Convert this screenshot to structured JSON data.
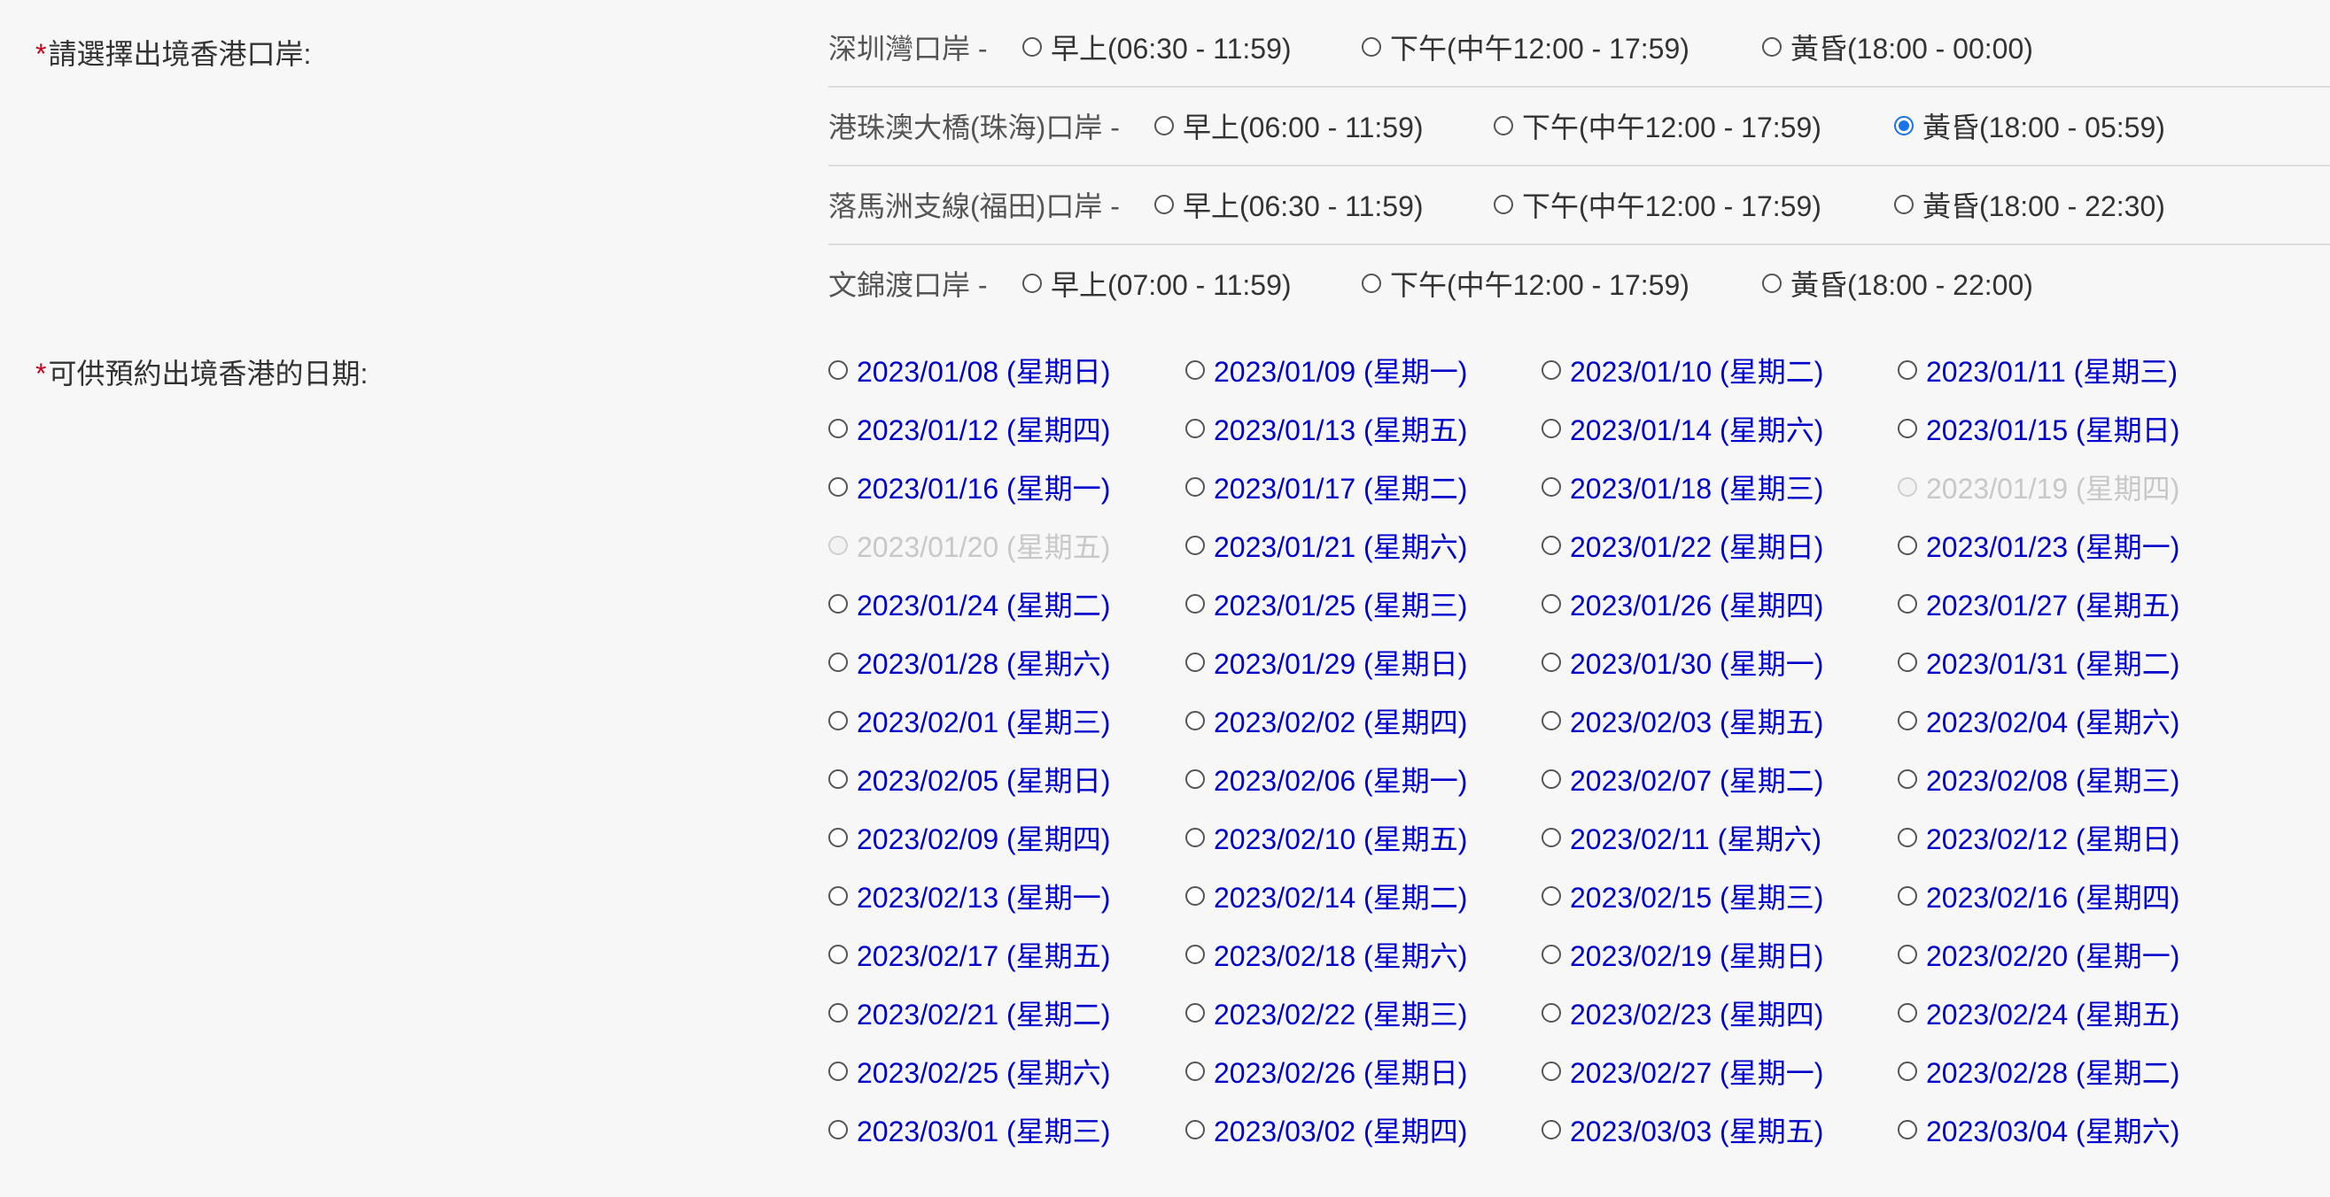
{
  "port_field": {
    "required_mark": "*",
    "label": "請選擇出境香港口岸:"
  },
  "ports": [
    {
      "name": "深圳灣口岸 -",
      "slots": [
        {
          "label": "早上(06:30 - 11:59)",
          "checked": false
        },
        {
          "label": "下午(中午12:00 - 17:59)",
          "checked": false
        },
        {
          "label": "黃昏(18:00 - 00:00)",
          "checked": false
        }
      ]
    },
    {
      "name": "港珠澳大橋(珠海)口岸 -",
      "slots": [
        {
          "label": "早上(06:00 - 11:59)",
          "checked": false
        },
        {
          "label": "下午(中午12:00 - 17:59)",
          "checked": false
        },
        {
          "label": "黃昏(18:00 - 05:59)",
          "checked": true
        }
      ]
    },
    {
      "name": "落馬洲支線(福田)口岸 -",
      "slots": [
        {
          "label": "早上(06:30 - 11:59)",
          "checked": false
        },
        {
          "label": "下午(中午12:00 - 17:59)",
          "checked": false
        },
        {
          "label": "黃昏(18:00 - 22:30)",
          "checked": false
        }
      ]
    },
    {
      "name": "文錦渡口岸 -",
      "slots": [
        {
          "label": "早上(07:00 - 11:59)",
          "checked": false
        },
        {
          "label": "下午(中午12:00 - 17:59)",
          "checked": false
        },
        {
          "label": "黃昏(18:00 - 22:00)",
          "checked": false
        }
      ]
    }
  ],
  "date_field": {
    "required_mark": "*",
    "label": "可供預約出境香港的日期:"
  },
  "dates": [
    {
      "label": "2023/01/08 (星期日)",
      "disabled": false
    },
    {
      "label": "2023/01/09 (星期一)",
      "disabled": false
    },
    {
      "label": "2023/01/10 (星期二)",
      "disabled": false
    },
    {
      "label": "2023/01/11 (星期三)",
      "disabled": false
    },
    {
      "label": "2023/01/12 (星期四)",
      "disabled": false
    },
    {
      "label": "2023/01/13 (星期五)",
      "disabled": false
    },
    {
      "label": "2023/01/14 (星期六)",
      "disabled": false
    },
    {
      "label": "2023/01/15 (星期日)",
      "disabled": false
    },
    {
      "label": "2023/01/16 (星期一)",
      "disabled": false
    },
    {
      "label": "2023/01/17 (星期二)",
      "disabled": false
    },
    {
      "label": "2023/01/18 (星期三)",
      "disabled": false
    },
    {
      "label": "2023/01/19 (星期四)",
      "disabled": true
    },
    {
      "label": "2023/01/20 (星期五)",
      "disabled": true
    },
    {
      "label": "2023/01/21 (星期六)",
      "disabled": false
    },
    {
      "label": "2023/01/22 (星期日)",
      "disabled": false
    },
    {
      "label": "2023/01/23 (星期一)",
      "disabled": false
    },
    {
      "label": "2023/01/24 (星期二)",
      "disabled": false
    },
    {
      "label": "2023/01/25 (星期三)",
      "disabled": false
    },
    {
      "label": "2023/01/26 (星期四)",
      "disabled": false
    },
    {
      "label": "2023/01/27 (星期五)",
      "disabled": false
    },
    {
      "label": "2023/01/28 (星期六)",
      "disabled": false
    },
    {
      "label": "2023/01/29 (星期日)",
      "disabled": false
    },
    {
      "label": "2023/01/30 (星期一)",
      "disabled": false
    },
    {
      "label": "2023/01/31 (星期二)",
      "disabled": false
    },
    {
      "label": "2023/02/01 (星期三)",
      "disabled": false
    },
    {
      "label": "2023/02/02 (星期四)",
      "disabled": false
    },
    {
      "label": "2023/02/03 (星期五)",
      "disabled": false
    },
    {
      "label": "2023/02/04 (星期六)",
      "disabled": false
    },
    {
      "label": "2023/02/05 (星期日)",
      "disabled": false
    },
    {
      "label": "2023/02/06 (星期一)",
      "disabled": false
    },
    {
      "label": "2023/02/07 (星期二)",
      "disabled": false
    },
    {
      "label": "2023/02/08 (星期三)",
      "disabled": false
    },
    {
      "label": "2023/02/09 (星期四)",
      "disabled": false
    },
    {
      "label": "2023/02/10 (星期五)",
      "disabled": false
    },
    {
      "label": "2023/02/11 (星期六)",
      "disabled": false
    },
    {
      "label": "2023/02/12 (星期日)",
      "disabled": false
    },
    {
      "label": "2023/02/13 (星期一)",
      "disabled": false
    },
    {
      "label": "2023/02/14 (星期二)",
      "disabled": false
    },
    {
      "label": "2023/02/15 (星期三)",
      "disabled": false
    },
    {
      "label": "2023/02/16 (星期四)",
      "disabled": false
    },
    {
      "label": "2023/02/17 (星期五)",
      "disabled": false
    },
    {
      "label": "2023/02/18 (星期六)",
      "disabled": false
    },
    {
      "label": "2023/02/19 (星期日)",
      "disabled": false
    },
    {
      "label": "2023/02/20 (星期一)",
      "disabled": false
    },
    {
      "label": "2023/02/21 (星期二)",
      "disabled": false
    },
    {
      "label": "2023/02/22 (星期三)",
      "disabled": false
    },
    {
      "label": "2023/02/23 (星期四)",
      "disabled": false
    },
    {
      "label": "2023/02/24 (星期五)",
      "disabled": false
    },
    {
      "label": "2023/02/25 (星期六)",
      "disabled": false
    },
    {
      "label": "2023/02/26 (星期日)",
      "disabled": false
    },
    {
      "label": "2023/02/27 (星期一)",
      "disabled": false
    },
    {
      "label": "2023/02/28 (星期二)",
      "disabled": false
    },
    {
      "label": "2023/03/01 (星期三)",
      "disabled": false
    },
    {
      "label": "2023/03/02 (星期四)",
      "disabled": false
    },
    {
      "label": "2023/03/03 (星期五)",
      "disabled": false
    },
    {
      "label": "2023/03/04 (星期六)",
      "disabled": false
    }
  ],
  "colors": {
    "date_link": "#0000cc",
    "date_disabled": "#c8c8c8",
    "required_mark": "#d0021b",
    "radio_checked": "#1a73e8"
  }
}
